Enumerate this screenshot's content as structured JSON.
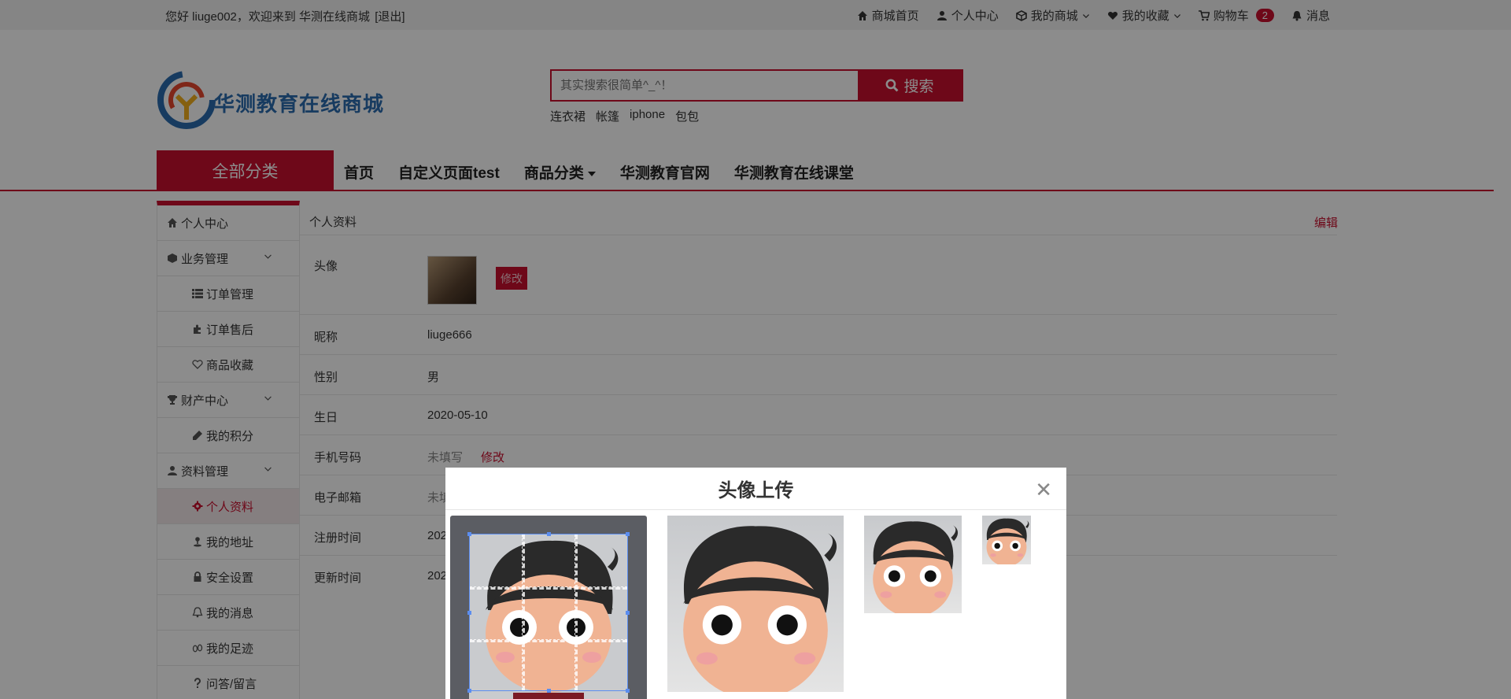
{
  "topbar": {
    "welcome_prefix": "您好 liuge002，欢迎来到 华测在线商城",
    "logout": "[退出]",
    "links": [
      {
        "label": "商城首页",
        "icon": "home-icon"
      },
      {
        "label": "个人中心",
        "icon": "user-icon"
      },
      {
        "label": "我的商城",
        "icon": "cube-icon"
      },
      {
        "label": "我的收藏",
        "icon": "heart-icon"
      },
      {
        "label": "购物车",
        "icon": "cart-icon"
      },
      {
        "label": "消息",
        "icon": "bell-icon"
      }
    ],
    "cart_count": "2"
  },
  "header": {
    "logo_text": "华测教育在线商城",
    "search_placeholder": "其实搜索很简单^_^！",
    "search_button": "搜索",
    "hot_words": [
      "连衣裙",
      "帐篷",
      "iphone",
      "包包"
    ]
  },
  "nav": {
    "all_categories": "全部分类",
    "items": [
      "首页",
      "自定义页面test",
      "商品分类",
      "华测教育官网",
      "华测教育在线课堂"
    ]
  },
  "sidebar": {
    "items": [
      {
        "label": "个人中心",
        "icon": "home-icon"
      },
      {
        "label": "业务管理",
        "icon": "cube-icon"
      },
      {
        "label": "订单管理",
        "icon": "list-icon"
      },
      {
        "label": "订单售后",
        "icon": "puzzle-icon"
      },
      {
        "label": "商品收藏",
        "icon": "heart-outline-icon"
      },
      {
        "label": "财产中心",
        "icon": "trophy-icon"
      },
      {
        "label": "我的积分",
        "icon": "pen-icon"
      },
      {
        "label": "资料管理",
        "icon": "user-icon"
      },
      {
        "label": "个人资料",
        "icon": "gear-icon"
      },
      {
        "label": "我的地址",
        "icon": "pin-icon"
      },
      {
        "label": "安全设置",
        "icon": "lock-icon"
      },
      {
        "label": "我的消息",
        "icon": "bell-outline-icon"
      },
      {
        "label": "我的足迹",
        "icon": "footprint-icon"
      },
      {
        "label": "问答/留言",
        "icon": "question-icon"
      }
    ]
  },
  "profile": {
    "title": "个人资料",
    "edit": "编辑",
    "avatar_label": "头像",
    "modify_button": "修改",
    "fields": [
      {
        "label": "昵称",
        "value": "liuge666"
      },
      {
        "label": "性别",
        "value": "男"
      },
      {
        "label": "生日",
        "value": "2020-05-10"
      },
      {
        "label": "手机号码",
        "value": "未填写"
      },
      {
        "label": "电子邮箱",
        "value": "未填"
      },
      {
        "label": "注册时间",
        "value": "202"
      },
      {
        "label": "更新时间",
        "value": "202"
      }
    ],
    "phone_modify": "修改"
  },
  "modal": {
    "title": "头像上传",
    "close_icon": "close-icon"
  },
  "colors": {
    "brand_red": "#c8102e",
    "logo_blue": "#2b6cb0"
  }
}
